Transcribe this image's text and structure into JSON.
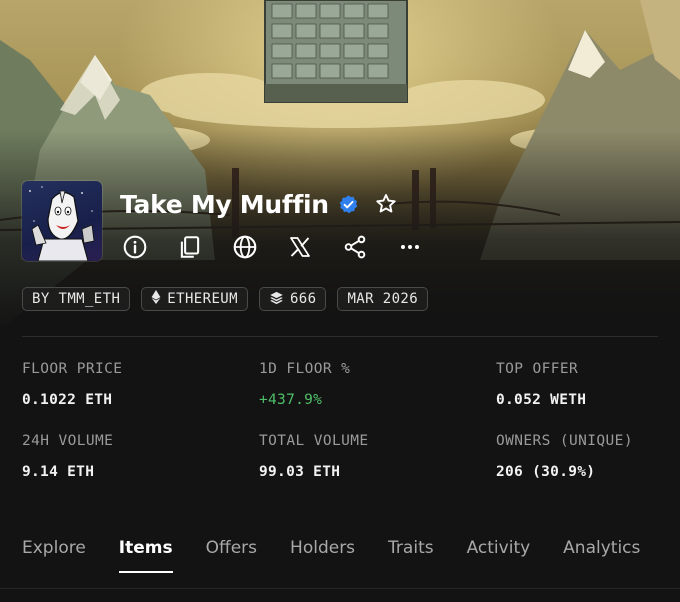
{
  "collection": {
    "name": "Take My Muffin",
    "verified": true
  },
  "actions": [
    {
      "name": "info-icon"
    },
    {
      "name": "copy-icon"
    },
    {
      "name": "globe-icon"
    },
    {
      "name": "x-logo-icon"
    },
    {
      "name": "share-icon"
    },
    {
      "name": "more-icon"
    }
  ],
  "chips": {
    "creator": "BY TMM_ETH",
    "chain": "ETHEREUM",
    "items": "666",
    "date": "MAR 2026"
  },
  "stats": {
    "floor_price": {
      "label": "FLOOR PRICE",
      "value": "0.1022 ETH"
    },
    "floor_change": {
      "label": "1D FLOOR %",
      "value": "+437.9%"
    },
    "top_offer": {
      "label": "TOP OFFER",
      "value": "0.052 WETH"
    },
    "volume_24h": {
      "label": "24H VOLUME",
      "value": "9.14 ETH"
    },
    "total_volume": {
      "label": "TOTAL VOLUME",
      "value": "99.03 ETH"
    },
    "owners": {
      "label": "OWNERS (UNIQUE)",
      "value": "206 (30.9%)"
    }
  },
  "tabs": {
    "explore": "Explore",
    "items": "Items",
    "offers": "Offers",
    "holders": "Holders",
    "traits": "Traits",
    "activity": "Activity",
    "analytics": "Analytics"
  },
  "active_tab": "Items",
  "colors": {
    "background": "#131313",
    "positive": "#4fbf6a",
    "verified": "#2f80ed"
  }
}
